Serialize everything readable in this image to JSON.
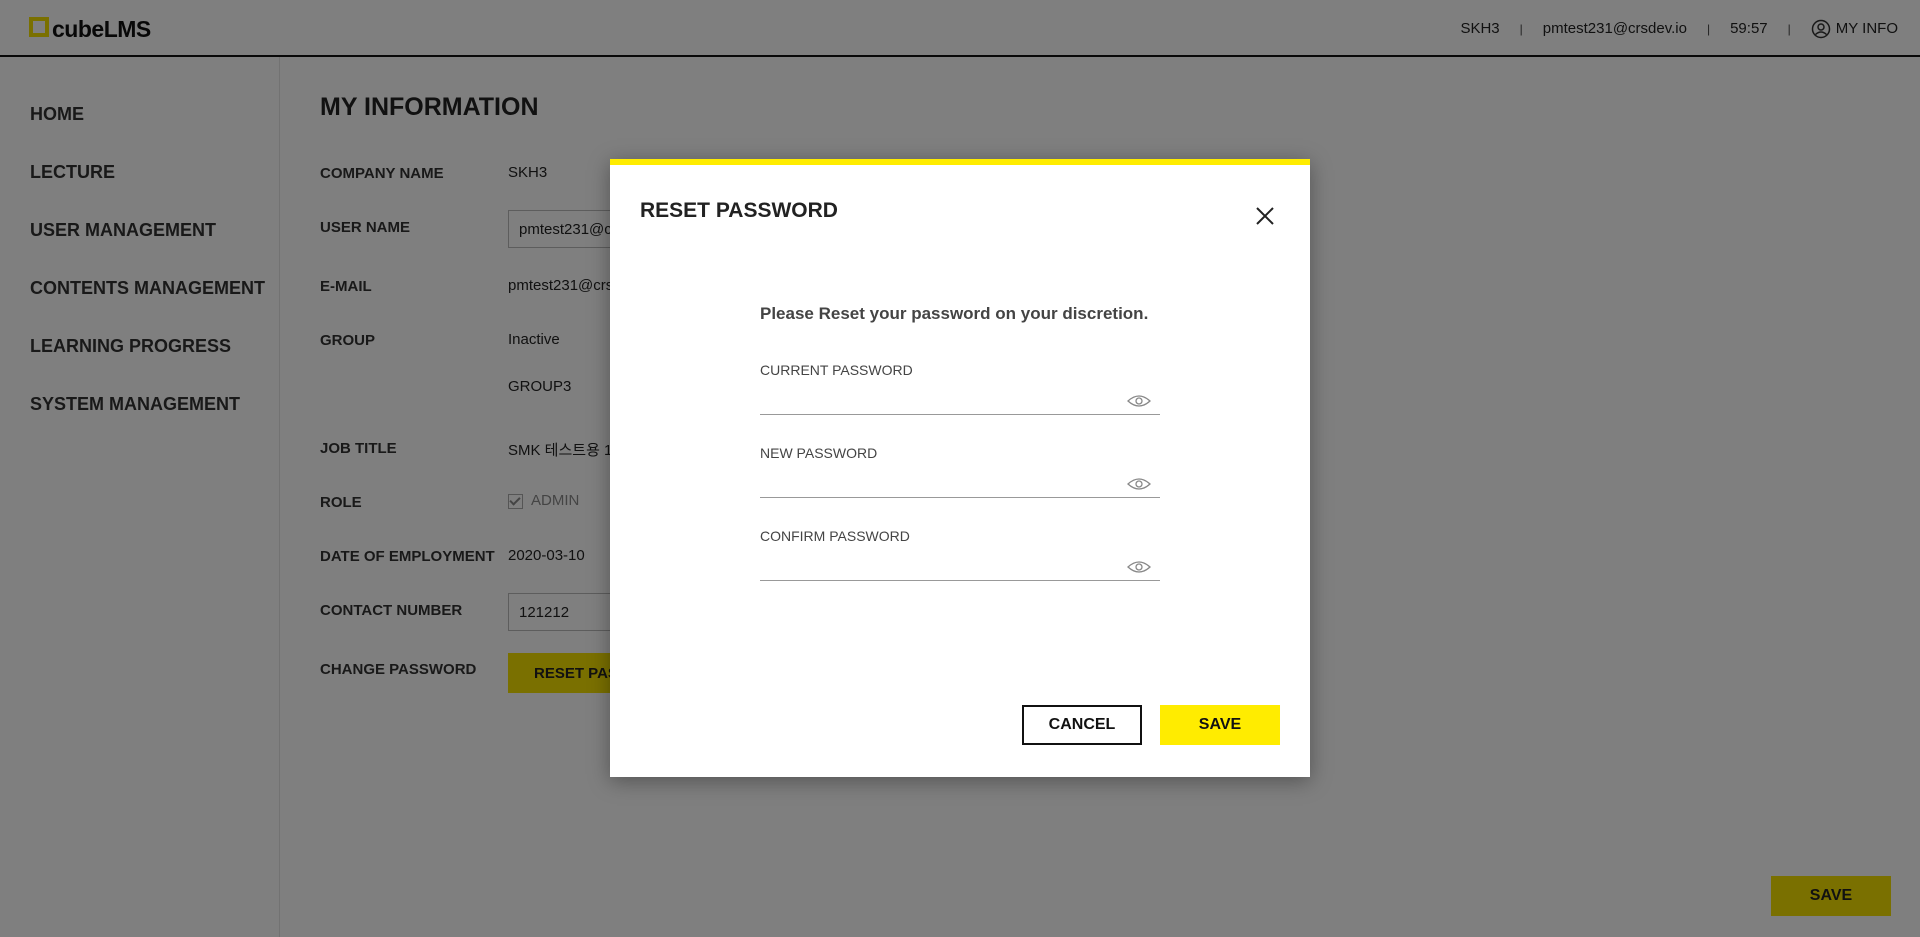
{
  "header": {
    "logo_prefix": "cube",
    "logo_suffix": "LMS",
    "company": "SKH3",
    "email": "pmtest231@crsdev.io",
    "timer": "59:57",
    "my_info": "MY INFO"
  },
  "sidebar": {
    "items": [
      {
        "label": "HOME"
      },
      {
        "label": "LECTURE"
      },
      {
        "label": "USER MANAGEMENT"
      },
      {
        "label": "CONTENTS MANAGEMENT"
      },
      {
        "label": "LEARNING PROGRESS"
      },
      {
        "label": "SYSTEM MANAGEMENT"
      }
    ]
  },
  "main": {
    "title": "MY INFORMATION",
    "company_label": "COMPANY NAME",
    "company_value": "SKH3",
    "username_label": "USER NAME",
    "username_value": "pmtest231@c",
    "email_label": "E-MAIL",
    "email_value": "pmtest231@crs",
    "group_label": "GROUP",
    "group_status": "Inactive",
    "group_value": "GROUP3",
    "job_label": "JOB TITLE",
    "job_value": "SMK 테스트용 1",
    "role_label": "ROLE",
    "role_value": "ADMIN",
    "doe_label": "DATE OF EMPLOYMENT",
    "doe_value": "2020-03-10",
    "contact_label": "CONTACT NUMBER",
    "contact_value": "121212",
    "change_pw_label": "CHANGE PASSWORD",
    "reset_pw_button": "RESET PASS",
    "save_button": "SAVE"
  },
  "modal": {
    "title": "RESET PASSWORD",
    "description": "Please Reset your password on your discretion.",
    "current_label": "CURRENT PASSWORD",
    "current_value": "",
    "new_label": "NEW PASSWORD",
    "new_value": "",
    "confirm_label": "CONFIRM PASSWORD",
    "confirm_value": "",
    "cancel_label": "CANCEL",
    "save_label": "SAVE",
    "accent_color": "#ffec00"
  }
}
